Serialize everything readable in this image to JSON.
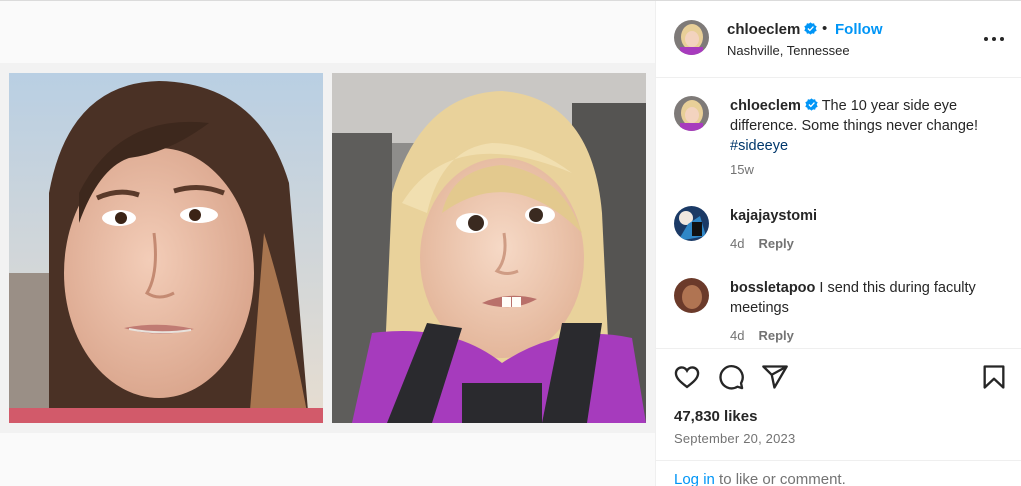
{
  "post": {
    "username": "chloeclem",
    "follow_label": "Follow",
    "separator": "•",
    "location": "Nashville, Tennessee"
  },
  "caption": {
    "username": "chloeclem",
    "text": " The 10 year side eye difference. Some things never change! ",
    "hashtag": "#sideeye",
    "age": "15w"
  },
  "comments": [
    {
      "username": "kajajaystomi",
      "text": "",
      "age": "4d",
      "reply_label": "Reply"
    },
    {
      "username": "bossletapoo",
      "text": "I send this during faculty meetings",
      "age": "4d",
      "reply_label": "Reply"
    }
  ],
  "stats": {
    "likes": "47,830 likes",
    "date": "September 20, 2023"
  },
  "login_prompt": {
    "link": "Log in",
    "rest": " to like or comment."
  },
  "icons": {
    "verified": "verified-badge-icon",
    "more": "more-options-icon",
    "like": "heart-icon",
    "comment": "comment-bubble-icon",
    "share": "share-paper-plane-icon",
    "save": "bookmark-icon"
  },
  "colors": {
    "link_blue": "#0095f6",
    "hashtag": "#00376b",
    "muted": "#737373",
    "text": "#262626"
  }
}
